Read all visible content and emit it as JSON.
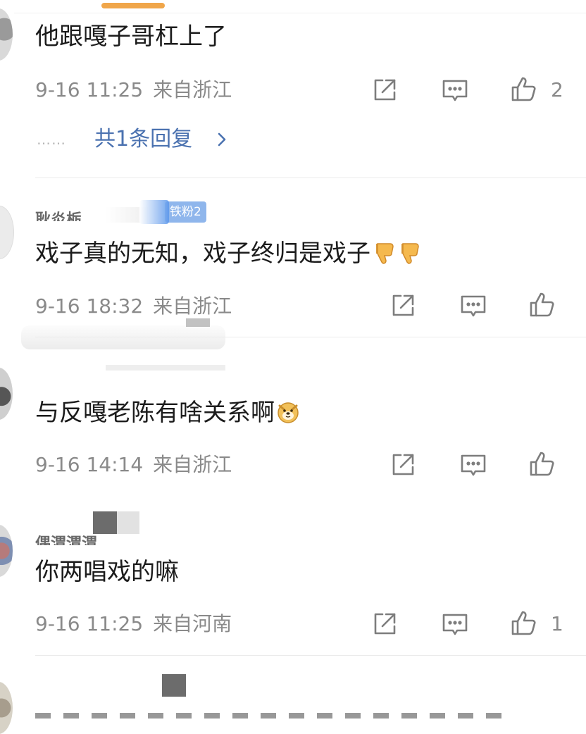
{
  "comments": [
    {
      "username": "",
      "badge": "",
      "text": "他跟嘎子哥杠上了",
      "date": "9-16 11:25",
      "location": "来自浙江",
      "likes": "2",
      "reply_summary": "共1条回复"
    },
    {
      "username": "耿炎栃",
      "badge": "铁粉2",
      "text": "戏子真的无知，戏子终归是戏子",
      "emoji": [
        "thumbs-down-emoji",
        "thumbs-down-emoji"
      ],
      "date": "9-16 18:32",
      "location": "来自浙江",
      "likes": ""
    },
    {
      "username": "",
      "badge": "",
      "text": "与反嘎老陈有啥关系啊",
      "emoji": [
        "doge-emoji"
      ],
      "date": "9-16 14:14",
      "location": "来自浙江",
      "likes": ""
    },
    {
      "username": "偶渭渭渭",
      "badge": "",
      "text": "你两唱戏的嘛",
      "date": "9-16 11:25",
      "location": "来自河南",
      "likes": "1"
    }
  ],
  "icons": {
    "share": "share-icon",
    "comment": "comment-icon",
    "like": "like-icon",
    "chevron": "chevron-right-icon"
  },
  "colors": {
    "accent_tab": "#f0a64a",
    "reply_link": "#4b72b0",
    "meta_text": "#8a8a8a",
    "badge_bg": "#8fb6ec"
  }
}
